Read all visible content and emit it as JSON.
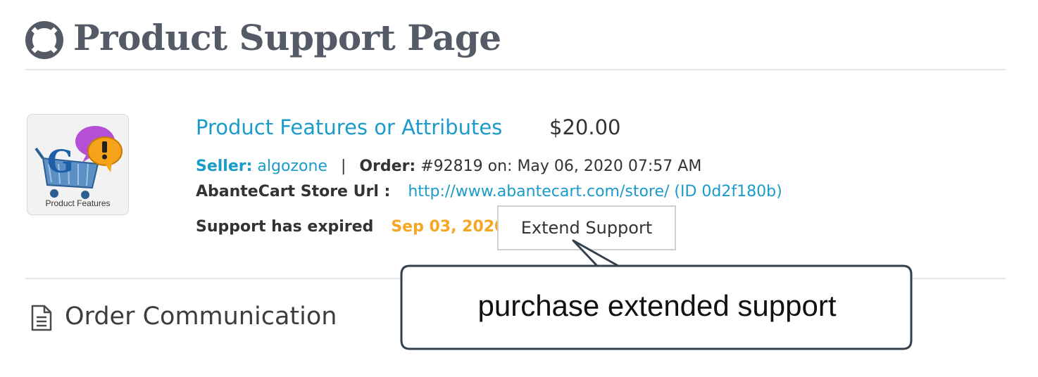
{
  "header": {
    "title": "Product Support Page",
    "icon": "life-ring-icon"
  },
  "product": {
    "thumbnail_caption": "Product Features",
    "name": "Product Features or Attributes",
    "price": "$20.00",
    "seller_label": "Seller:",
    "seller_name": "algozone",
    "separator": "|",
    "order_label": "Order:",
    "order_value": "#92819 on: May 06, 2020 07:57 AM",
    "store_url_label": "AbanteCart Store Url :",
    "store_url_value": "http://www.abantecart.com/store/ (ID 0d2f180b)",
    "support_status": "Support has expired",
    "support_date": "Sep 03, 2020",
    "extend_button": "Extend Support"
  },
  "communication": {
    "title": "Order Communication",
    "icon": "document-icon"
  },
  "callout": {
    "text": "purchase extended support"
  },
  "colors": {
    "link": "#1a9bc9",
    "warning": "#f5a623",
    "title": "#545b66"
  }
}
